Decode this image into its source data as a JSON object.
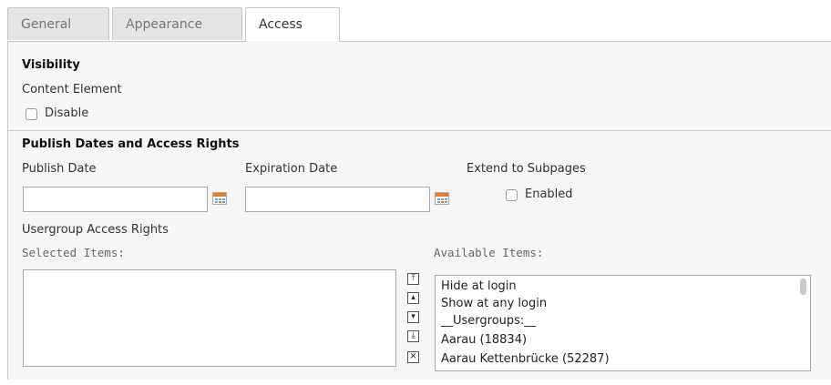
{
  "tabs": [
    {
      "label": "General"
    },
    {
      "label": "Appearance"
    },
    {
      "label": "Access"
    }
  ],
  "visibility": {
    "heading": "Visibility",
    "field_label": "Content Element",
    "disable_label": "Disable"
  },
  "publish": {
    "heading": "Publish Dates and Access Rights",
    "publish_date_label": "Publish Date",
    "publish_date_value": "",
    "expiration_date_label": "Expiration Date",
    "expiration_date_value": "",
    "extend_label": "Extend to Subpages",
    "enabled_label": "Enabled",
    "usergroup_label": "Usergroup Access Rights",
    "selected_label": "Selected Items:",
    "available_label": "Available Items:",
    "selected_items": [],
    "available_items": [
      "Hide at login",
      "Show at any login",
      "__Usergroups:__",
      "Aarau (18834)",
      "Aarau Kettenbrücke (52287)"
    ],
    "controls": [
      "move-top",
      "move-up",
      "move-down",
      "move-bottom",
      "remove"
    ]
  }
}
